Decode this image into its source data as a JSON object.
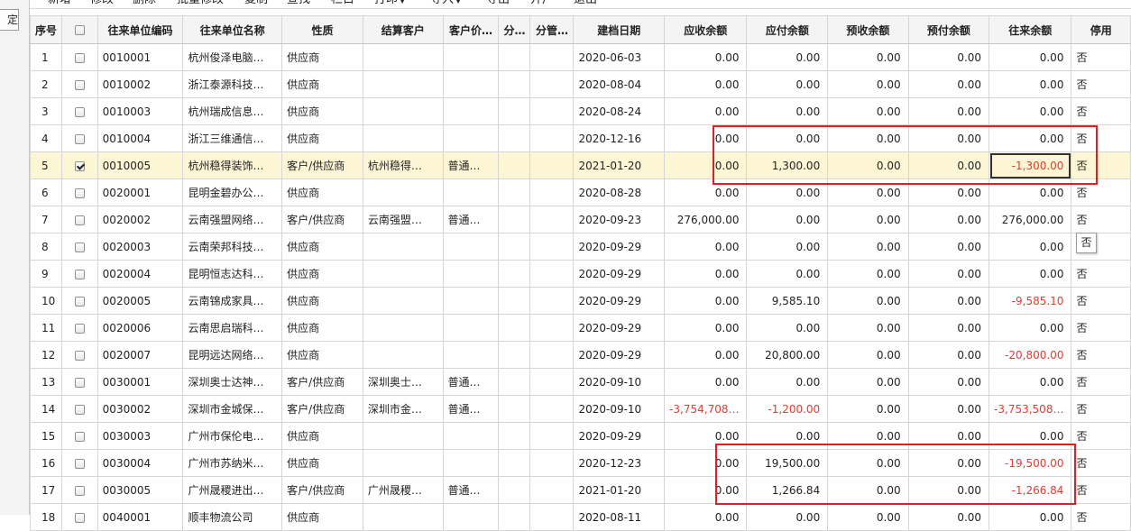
{
  "side_panel": {
    "button_label": "定位"
  },
  "toolbar": {
    "items": [
      "新增",
      "修改",
      "删除",
      "批量修改",
      "复制",
      "查找",
      "栏目",
      "打印",
      "导入",
      "导出",
      "开户",
      "退出"
    ]
  },
  "table": {
    "columns": [
      "序号",
      "",
      "往来单位编码",
      "往来单位名称",
      "性质",
      "结算客户",
      "客户价…",
      "分…",
      "分管…",
      "建档日期",
      "应收余额",
      "应付余额",
      "预收余额",
      "预付余额",
      "往来余额",
      "停用"
    ],
    "rows": [
      {
        "idx": "1",
        "checked": false,
        "code": "0010001",
        "name": "杭州俊泽电脑…",
        "type": "供应商",
        "client": "",
        "price": "",
        "f1": "",
        "f2": "",
        "date": "2020-06-03",
        "ar": "0.00",
        "ap": "0.00",
        "pr": "0.00",
        "pp": "0.00",
        "bal": "0.00",
        "stop": "否"
      },
      {
        "idx": "2",
        "checked": false,
        "code": "0010002",
        "name": "浙江泰源科技…",
        "type": "供应商",
        "client": "",
        "price": "",
        "f1": "",
        "f2": "",
        "date": "2020-08-04",
        "ar": "0.00",
        "ap": "0.00",
        "pr": "0.00",
        "pp": "0.00",
        "bal": "0.00",
        "stop": "否"
      },
      {
        "idx": "3",
        "checked": false,
        "code": "0010003",
        "name": "杭州瑞成信息…",
        "type": "供应商",
        "client": "",
        "price": "",
        "f1": "",
        "f2": "",
        "date": "2020-08-24",
        "ar": "0.00",
        "ap": "0.00",
        "pr": "0.00",
        "pp": "0.00",
        "bal": "0.00",
        "stop": "否"
      },
      {
        "idx": "4",
        "checked": false,
        "code": "0010004",
        "name": "浙江三维通信…",
        "type": "供应商",
        "client": "",
        "price": "",
        "f1": "",
        "f2": "",
        "date": "2020-12-16",
        "ar": "0.00",
        "ap": "0.00",
        "pr": "0.00",
        "pp": "0.00",
        "bal": "0.00",
        "stop": "否"
      },
      {
        "idx": "5",
        "checked": true,
        "code": "0010005",
        "name": "杭州稳得装饰…",
        "type": "客户/供应商",
        "client": "杭州稳得…",
        "price": "普通…",
        "f1": "",
        "f2": "",
        "date": "2021-01-20",
        "ar": "0.00",
        "ap": "1,300.00",
        "pr": "0.00",
        "pp": "0.00",
        "bal": "-1,300.00",
        "stop": "否"
      },
      {
        "idx": "6",
        "checked": false,
        "code": "0020001",
        "name": "昆明金碧办公…",
        "type": "供应商",
        "client": "",
        "price": "",
        "f1": "",
        "f2": "",
        "date": "2020-08-28",
        "ar": "0.00",
        "ap": "0.00",
        "pr": "0.00",
        "pp": "0.00",
        "bal": "0.00",
        "stop": "否"
      },
      {
        "idx": "7",
        "checked": false,
        "code": "0020002",
        "name": "云南强盟网络…",
        "type": "客户/供应商",
        "client": "云南强盟…",
        "price": "普通…",
        "f1": "",
        "f2": "",
        "date": "2020-09-23",
        "ar": "276,000.00",
        "ap": "0.00",
        "pr": "0.00",
        "pp": "0.00",
        "bal": "276,000.00",
        "stop": "否"
      },
      {
        "idx": "8",
        "checked": false,
        "code": "0020003",
        "name": "云南荣邦科技…",
        "type": "供应商",
        "client": "",
        "price": "",
        "f1": "",
        "f2": "",
        "date": "2020-09-29",
        "ar": "0.00",
        "ap": "0.00",
        "pr": "0.00",
        "pp": "0.00",
        "bal": "0.00",
        "stop": ""
      },
      {
        "idx": "9",
        "checked": false,
        "code": "0020004",
        "name": "昆明恒志达科…",
        "type": "供应商",
        "client": "",
        "price": "",
        "f1": "",
        "f2": "",
        "date": "2020-09-29",
        "ar": "0.00",
        "ap": "0.00",
        "pr": "0.00",
        "pp": "0.00",
        "bal": "0.00",
        "stop": "否"
      },
      {
        "idx": "10",
        "checked": false,
        "code": "0020005",
        "name": "云南锦成家具…",
        "type": "供应商",
        "client": "",
        "price": "",
        "f1": "",
        "f2": "",
        "date": "2020-09-29",
        "ar": "0.00",
        "ap": "9,585.10",
        "pr": "0.00",
        "pp": "0.00",
        "bal": "-9,585.10",
        "stop": "否"
      },
      {
        "idx": "11",
        "checked": false,
        "code": "0020006",
        "name": "云南思启瑞科…",
        "type": "供应商",
        "client": "",
        "price": "",
        "f1": "",
        "f2": "",
        "date": "2020-09-29",
        "ar": "0.00",
        "ap": "0.00",
        "pr": "0.00",
        "pp": "0.00",
        "bal": "0.00",
        "stop": "否"
      },
      {
        "idx": "12",
        "checked": false,
        "code": "0020007",
        "name": "昆明远达网络…",
        "type": "供应商",
        "client": "",
        "price": "",
        "f1": "",
        "f2": "",
        "date": "2020-09-29",
        "ar": "0.00",
        "ap": "20,800.00",
        "pr": "0.00",
        "pp": "0.00",
        "bal": "-20,800.00",
        "stop": "否"
      },
      {
        "idx": "13",
        "checked": false,
        "code": "0030001",
        "name": "深圳奥士达神…",
        "type": "客户/供应商",
        "client": "深圳奥士…",
        "price": "普通…",
        "f1": "",
        "f2": "",
        "date": "2020-09-10",
        "ar": "0.00",
        "ap": "0.00",
        "pr": "0.00",
        "pp": "0.00",
        "bal": "0.00",
        "stop": "否"
      },
      {
        "idx": "14",
        "checked": false,
        "code": "0030002",
        "name": "深圳市金城保…",
        "type": "客户/供应商",
        "client": "深圳市金…",
        "price": "普通…",
        "f1": "",
        "f2": "",
        "date": "2020-09-10",
        "ar": "-3,754,708…",
        "ap": "-1,200.00",
        "pr": "0.00",
        "pp": "0.00",
        "bal": "-3,753,508…",
        "stop": "否"
      },
      {
        "idx": "15",
        "checked": false,
        "code": "0030003",
        "name": "广州市保伦电…",
        "type": "供应商",
        "client": "",
        "price": "",
        "f1": "",
        "f2": "",
        "date": "2020-09-29",
        "ar": "0.00",
        "ap": "0.00",
        "pr": "0.00",
        "pp": "0.00",
        "bal": "0.00",
        "stop": "否"
      },
      {
        "idx": "16",
        "checked": false,
        "code": "0030004",
        "name": "广州市苏纳米…",
        "type": "供应商",
        "client": "",
        "price": "",
        "f1": "",
        "f2": "",
        "date": "2020-12-23",
        "ar": "0.00",
        "ap": "19,500.00",
        "pr": "0.00",
        "pp": "0.00",
        "bal": "-19,500.00",
        "stop": "否"
      },
      {
        "idx": "17",
        "checked": false,
        "code": "0030005",
        "name": "广州晟稷进出…",
        "type": "客户/供应商",
        "client": "广州晟稷…",
        "price": "普通…",
        "f1": "",
        "f2": "",
        "date": "2021-01-20",
        "ar": "0.00",
        "ap": "1,266.84",
        "pr": "0.00",
        "pp": "0.00",
        "bal": "-1,266.84",
        "stop": "否"
      },
      {
        "idx": "18",
        "checked": false,
        "code": "0040001",
        "name": "顺丰物流公司",
        "type": "供应商",
        "client": "",
        "price": "",
        "f1": "",
        "f2": "",
        "date": "2020-08-11",
        "ar": "0.00",
        "ap": "0.00",
        "pr": "0.00",
        "pp": "0.00",
        "bal": "0.00",
        "stop": "否"
      }
    ]
  },
  "tooltip": {
    "text": "否"
  },
  "colors": {
    "negative": "#e23c2f",
    "selected_row": "#fdf6d5",
    "highlight_box": "#e02020"
  }
}
